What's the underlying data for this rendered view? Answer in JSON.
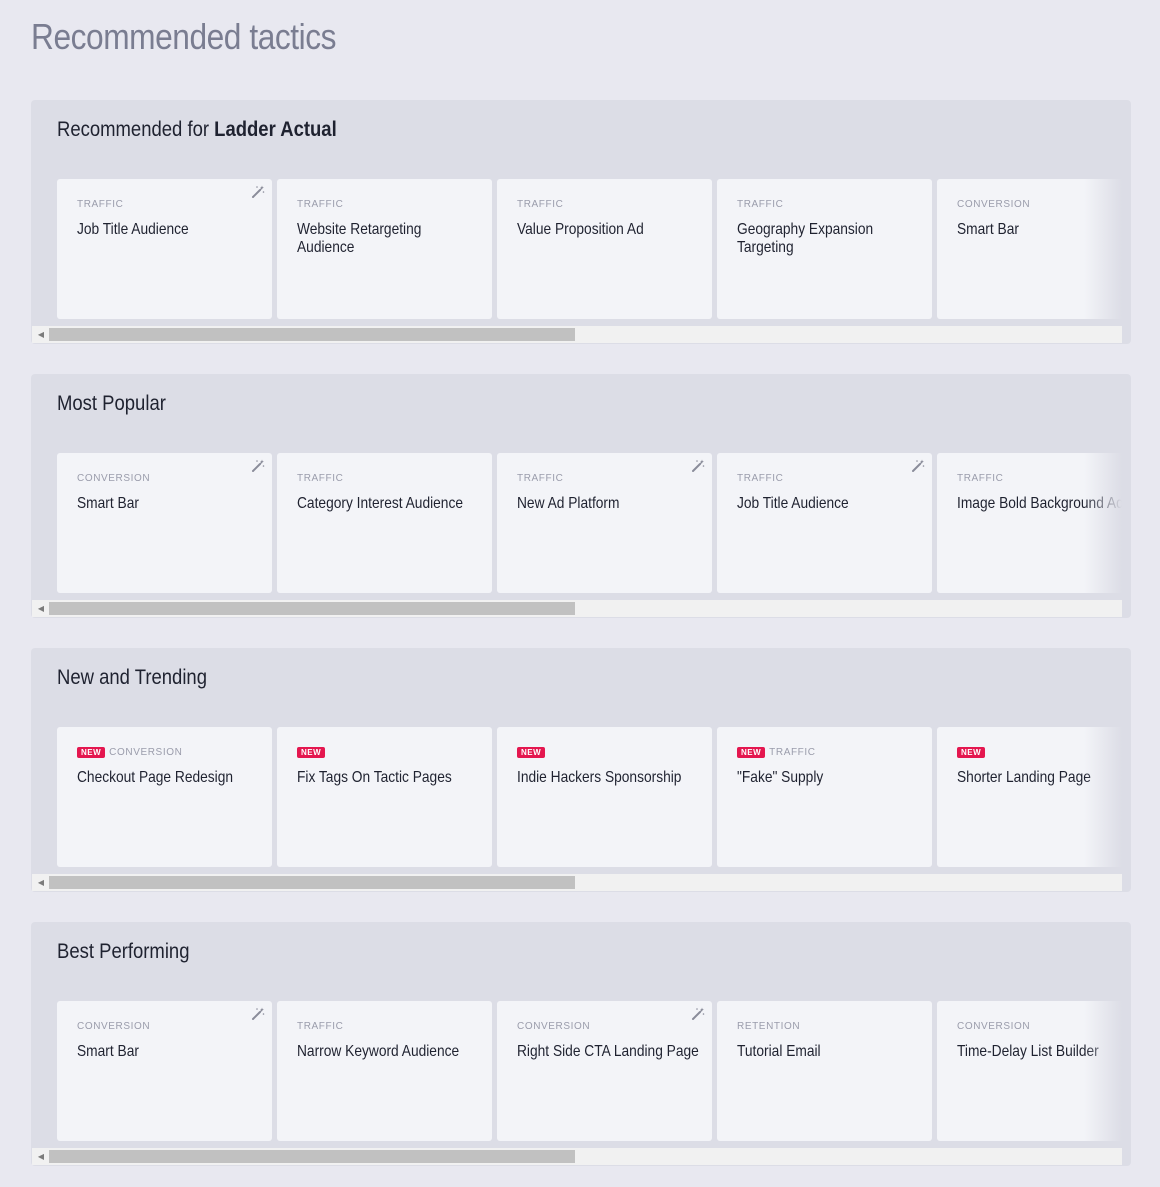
{
  "page": {
    "title": "Recommended tactics"
  },
  "sections": [
    {
      "title_prefix": "Recommended for ",
      "title_bold": "Ladder Actual",
      "cards": [
        {
          "category": "TRAFFIC",
          "title": "Job Title Audience",
          "is_new": false,
          "has_wand": true
        },
        {
          "category": "TRAFFIC",
          "title": "Website Retargeting Audience",
          "is_new": false,
          "has_wand": false
        },
        {
          "category": "TRAFFIC",
          "title": "Value Proposition Ad",
          "is_new": false,
          "has_wand": false
        },
        {
          "category": "TRAFFIC",
          "title": "Geography Expansion Targeting",
          "is_new": false,
          "has_wand": false
        },
        {
          "category": "CONVERSION",
          "title": "Smart Bar",
          "is_new": false,
          "has_wand": false
        }
      ]
    },
    {
      "title_prefix": "Most Popular",
      "title_bold": "",
      "cards": [
        {
          "category": "CONVERSION",
          "title": "Smart Bar",
          "is_new": false,
          "has_wand": true
        },
        {
          "category": "TRAFFIC",
          "title": "Category Interest Audience",
          "is_new": false,
          "has_wand": false
        },
        {
          "category": "TRAFFIC",
          "title": "New Ad Platform",
          "is_new": false,
          "has_wand": true
        },
        {
          "category": "TRAFFIC",
          "title": "Job Title Audience",
          "is_new": false,
          "has_wand": true
        },
        {
          "category": "TRAFFIC",
          "title": "Image Bold Background Ad",
          "is_new": false,
          "has_wand": false
        }
      ]
    },
    {
      "title_prefix": "New and Trending",
      "title_bold": "",
      "cards": [
        {
          "category": "CONVERSION",
          "title": "Checkout Page Redesign",
          "is_new": true,
          "has_wand": false
        },
        {
          "category": "",
          "title": "Fix Tags On Tactic Pages",
          "is_new": true,
          "has_wand": false
        },
        {
          "category": "",
          "title": "Indie Hackers Sponsorship",
          "is_new": true,
          "has_wand": false
        },
        {
          "category": "TRAFFIC",
          "title": "\"Fake\" Supply",
          "is_new": true,
          "has_wand": false
        },
        {
          "category": "",
          "title": "Shorter Landing Page",
          "is_new": true,
          "has_wand": false
        }
      ]
    },
    {
      "title_prefix": "Best Performing",
      "title_bold": "",
      "cards": [
        {
          "category": "CONVERSION",
          "title": "Smart Bar",
          "is_new": false,
          "has_wand": true
        },
        {
          "category": "TRAFFIC",
          "title": "Narrow Keyword Audience",
          "is_new": false,
          "has_wand": false
        },
        {
          "category": "CONVERSION",
          "title": "Right Side CTA Landing Page",
          "is_new": false,
          "has_wand": true
        },
        {
          "category": "RETENTION",
          "title": "Tutorial Email",
          "is_new": false,
          "has_wand": false
        },
        {
          "category": "CONVERSION",
          "title": "Time-Delay List Builder",
          "is_new": false,
          "has_wand": false
        }
      ]
    }
  ],
  "labels": {
    "new_badge": "NEW",
    "scroll_left": "◀"
  },
  "colors": {
    "background": "#e8e8f0",
    "section_background": "#dcdde6",
    "card_background": "#f3f4f8",
    "new_badge": "#e4164f",
    "category_text": "#9a9cab",
    "title_text": "#1f2230",
    "page_title": "#7a7d91"
  },
  "icons": {
    "card_action": "magic-wand-icon"
  }
}
